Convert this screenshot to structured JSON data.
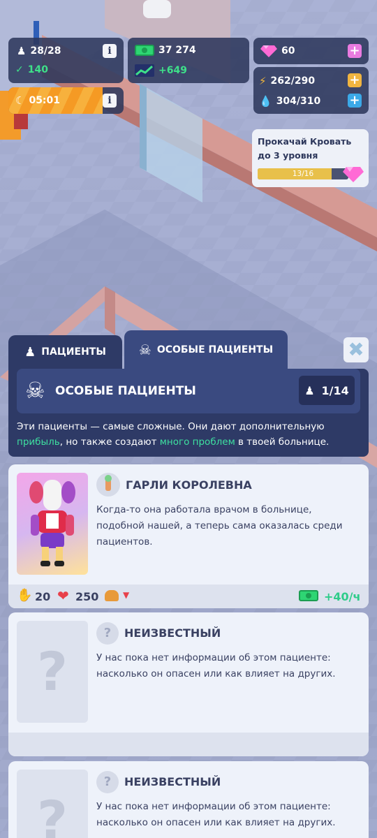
{
  "hud": {
    "patients": "28/28",
    "staff_energy": "140",
    "timer": "05:01",
    "money": "37 274",
    "money_rate": "+649",
    "gems": "60",
    "energy": "262/290",
    "water": "304/310"
  },
  "quest": {
    "text": "Прокачай Кровать до 3 уровня",
    "progress_label": "13/16",
    "progress": 0.8125
  },
  "tabs": {
    "patients": "ПАЦИЕНТЫ",
    "special": "ОСОБЫЕ ПАЦИЕНТЫ"
  },
  "header": {
    "title": "ОСОБЫЕ ПАЦИЕНТЫ",
    "count": "1/14",
    "desc_part1": "Эти пациенты — самые сложные. Они дают дополнительную ",
    "desc_hl1": "прибыль",
    "desc_part2": ", но также создают ",
    "desc_hl2": "много проблем",
    "desc_part3": " в твоей больнице."
  },
  "patients": [
    {
      "name": "ГАРЛИ КОРОЛЕВНА",
      "description": "Когда-то она работала врачом в больнице, подобной нашей, а теперь сама оказалась среди пациентов.",
      "stat_claw": "20",
      "stat_health": "250",
      "income": "+40/ч"
    },
    {
      "name": "НЕИЗВЕСТНЫЙ",
      "description": "У нас пока нет информации об этом пациенте: насколько он опасен или как влияет на других."
    },
    {
      "name": "НЕИЗВЕСТНЫЙ",
      "description": "У нас пока нет информации об этом пациенте: насколько он опасен или как влияет на других."
    }
  ],
  "colors": {
    "accent_green": "#2ecc8a",
    "panel_dark": "#2e3a66",
    "gem_pink": "#ff6ad5",
    "progress_yellow": "#e8c04a"
  }
}
